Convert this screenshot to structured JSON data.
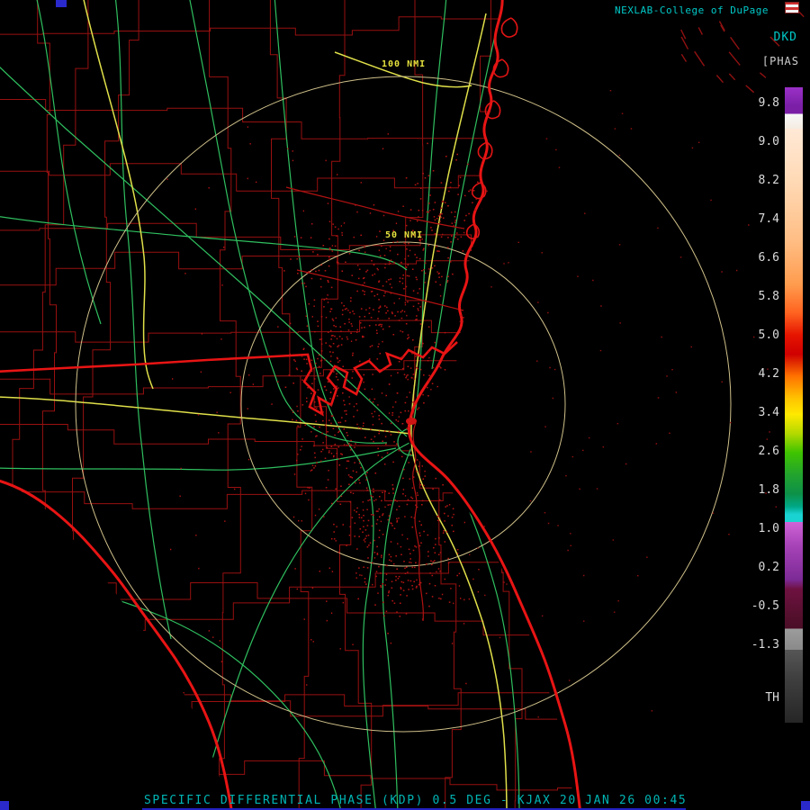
{
  "header": {
    "title": "NEXLAB-College of DuPage",
    "product_code": "DKD",
    "product_unit": "[PHAS"
  },
  "colorbar": {
    "ticks": [
      "9.8",
      "9.0",
      "8.2",
      "7.4",
      "6.6",
      "5.8",
      "5.0",
      "4.2",
      "3.4",
      "2.6",
      "1.8",
      "1.0",
      "0.2",
      "-0.5",
      "-1.3"
    ],
    "threshold_label": "TH",
    "gradient": [
      {
        "p": 0.0,
        "c": "#9b30c8"
      },
      {
        "p": 0.03,
        "c": "#7a1fa6"
      },
      {
        "p": 0.042,
        "c": "#7a1fa6"
      },
      {
        "p": 0.042,
        "c": "#f8f8f8"
      },
      {
        "p": 0.065,
        "c": "#f4ece2"
      },
      {
        "p": 0.065,
        "c": "#ffe9d6"
      },
      {
        "p": 0.15,
        "c": "#ffd9b4"
      },
      {
        "p": 0.24,
        "c": "#ffbe85"
      },
      {
        "p": 0.31,
        "c": "#ff9c4e"
      },
      {
        "p": 0.355,
        "c": "#ff6320"
      },
      {
        "p": 0.39,
        "c": "#e51400"
      },
      {
        "p": 0.42,
        "c": "#cf0000"
      },
      {
        "p": 0.455,
        "c": "#ff7300"
      },
      {
        "p": 0.49,
        "c": "#ffc400"
      },
      {
        "p": 0.515,
        "c": "#ffe900"
      },
      {
        "p": 0.545,
        "c": "#b3d900"
      },
      {
        "p": 0.575,
        "c": "#3fc400"
      },
      {
        "p": 0.61,
        "c": "#22a32e"
      },
      {
        "p": 0.64,
        "c": "#0d9148"
      },
      {
        "p": 0.66,
        "c": "#00a887"
      },
      {
        "p": 0.672,
        "c": "#19d2d2"
      },
      {
        "p": 0.684,
        "c": "#19d2d2"
      },
      {
        "p": 0.684,
        "c": "#cf63d6"
      },
      {
        "p": 0.72,
        "c": "#a844b8"
      },
      {
        "p": 0.775,
        "c": "#7c2a96"
      },
      {
        "p": 0.79,
        "c": "#6e1140"
      },
      {
        "p": 0.83,
        "c": "#55102e"
      },
      {
        "p": 0.852,
        "c": "#4a0d26"
      },
      {
        "p": 0.852,
        "c": "#9c9c9c"
      },
      {
        "p": 0.885,
        "c": "#8a8a8a"
      },
      {
        "p": 0.885,
        "c": "#565656"
      },
      {
        "p": 0.93,
        "c": "#3f3f3f"
      },
      {
        "p": 1.0,
        "c": "#262626"
      }
    ]
  },
  "rings": [
    {
      "label": "100 NMI"
    },
    {
      "label": "50 NMI"
    }
  ],
  "status_bar": {
    "text": "SPECIFIC DIFFERENTIAL PHASE (KDP) 0.5 DEG - KJAX 20 JAN 26 00:45"
  },
  "colors": {
    "cyan_text": "#00c8c8",
    "tick_text": "#dcdcdc",
    "yellow_label": "#e6e23e",
    "ring": "#cfc089",
    "county": "#a81212",
    "coast": "#e81414",
    "road_green": "#2fbf5f",
    "road_yellow": "#e0e04a",
    "speckle": "#b31414"
  }
}
